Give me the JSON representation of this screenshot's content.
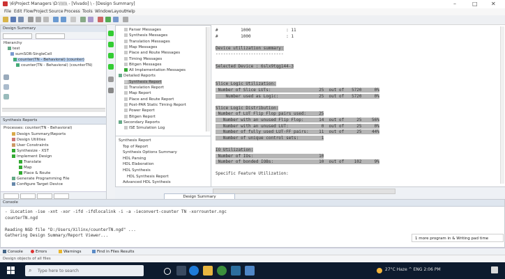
{
  "window": {
    "title": "\\6\\Project Managers \\D:\\\\\\\\\\\\ - [Vivado] \\ - [Design Summary]",
    "controls": {
      "minimize": "–",
      "maximize": "□",
      "close": "✕"
    }
  },
  "menu": [
    "File",
    "Edit",
    "Flow",
    "Project",
    "Source",
    "Process",
    "Tools",
    "Window",
    "Layout",
    "Help"
  ],
  "sources_panel": {
    "title": "Design Summary",
    "lines": [
      "Hierarchy",
      "test",
      "sumSOR-SingleCell",
      "counter(TN - Behavioral) (counter)",
      "counter(TN - Behavioral) (counterTN)"
    ]
  },
  "processes_panel": {
    "title": "Synthesis Reports",
    "header": "Processes: counter(TN - Behavioral)",
    "lines": [
      "Design Summary/Reports",
      "Design Utilities",
      "User Constraints",
      "Synthesize - XST",
      "Implement Design",
      "Translate",
      "Map",
      "Place & Route",
      "Generate Programming File",
      "Configure Target Device"
    ]
  },
  "report_tree": {
    "lines": [
      "Parser Messages",
      "Synthesis Messages",
      "Translation Messages",
      "Map Messages",
      "Place and Route Messages",
      "Timing Messages",
      "Bitgen Messages",
      "All Implementation Messages",
      "Detailed Reports",
      "Synthesis Report",
      "Translation Report",
      "Map Report",
      "Place and Route Report",
      "Post-PAR Static Timing Report",
      "Power Report",
      "Bitgen Report",
      "Secondary Reports",
      "ISE Simulation Log"
    ],
    "lower_lines": [
      "Synthesis Report",
      "Top of Report",
      "Synthesis Options Summary",
      "HDL Parsing",
      "HDL Elaboration",
      "HDL Synthesis",
      "HDL Synthesis Report",
      "Advanced HDL Synthesis",
      "Advanced HDL Synthesis Report"
    ]
  },
  "editor_tab": "Design Summary",
  "report": {
    "lines": [
      "#         1000              : 11",
      "#         1000              : 1",
      "",
      "Device utilization summary:",
      "---------------------------",
      "",
      "Selected Device : 6slx9tqg144-3",
      "",
      "",
      "Slice Logic Utilization:",
      " Number of Slice LUTs:                   25  out of   5720     0%",
      "    Number used as Logic:                25  out of   5720     0%",
      "",
      "Slice Logic Distribution:",
      " Number of LUT Flip Flop pairs used:     25",
      "   Number with an unused Flip Flop:      14  out of     25    56%",
      "   Number with an unused LUT:             0  out of     25     0%",
      "   Number of fully used LUT-FF pairs:    11  out of     25    44%",
      "   Number of unique control sets:         1",
      "",
      "IO Utilization:",
      " Number of IOs:                          10",
      " Number of bonded IOBs:                  10  out of    102     9%",
      "",
      "Specific Feature Utilization:"
    ]
  },
  "console": {
    "title": "Console",
    "lines": [
      "- iLocation -ise -xnt -xor -ifd -ifdlocalink -i -a -ieconvert-counter TN -xorrounter.ngc",
      "counterTN.ngd",
      "",
      "Reading NGD file \"D:/Users/Xilinx/counterTN.ngd\" ...",
      "Gathering Design Summary/Report Viewer..."
    ]
  },
  "bottom_tabs": [
    "Console",
    "Errors",
    "Warnings",
    "Find in Files Results"
  ],
  "status": "Design objects of all files",
  "notification": "1 more program in & Writing pad time",
  "taskbar": {
    "search_placeholder": "Type here to search",
    "tray": "27°C  Haze  ^  ENG  2:06 PM"
  }
}
